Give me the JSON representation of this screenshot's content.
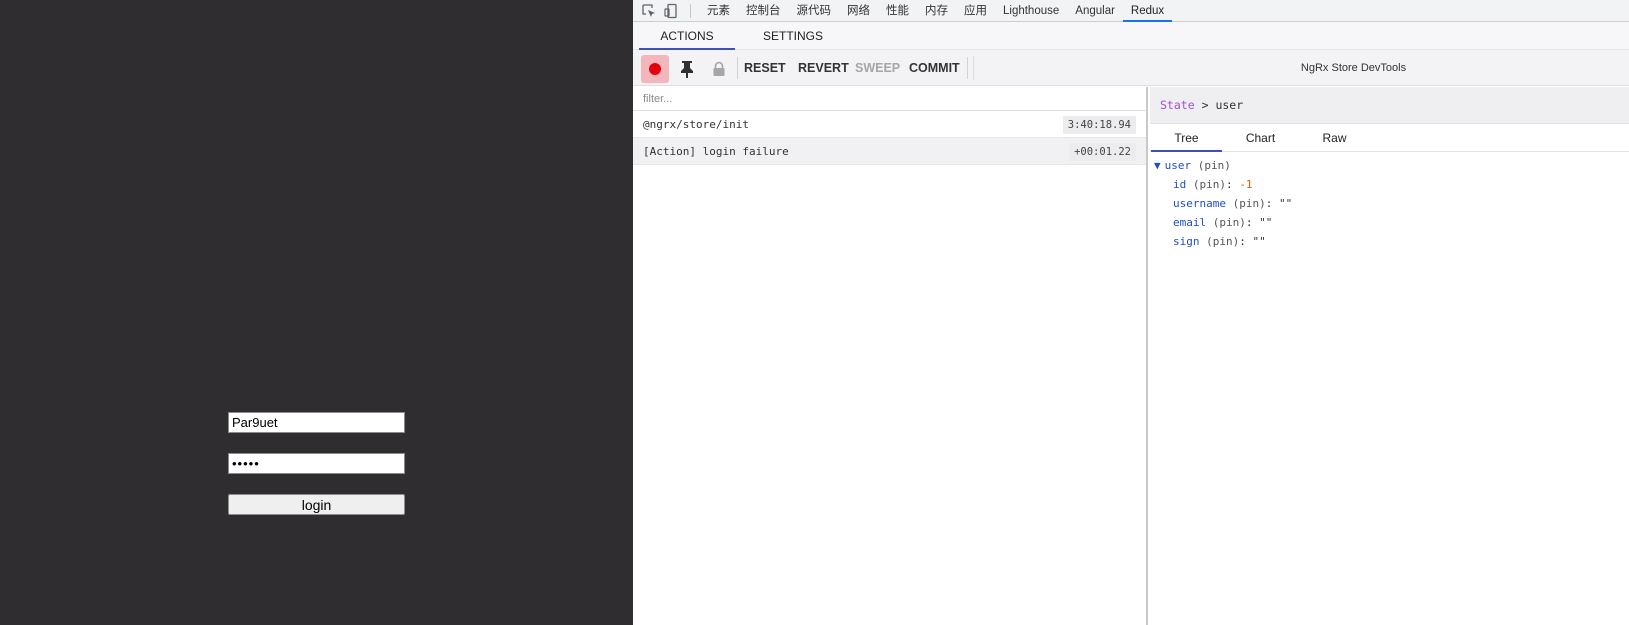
{
  "app": {
    "username_value": "Par9uet",
    "password_value": "•••••",
    "login_label": "login"
  },
  "devtools_tabs": [
    "元素",
    "控制台",
    "源代码",
    "网络",
    "性能",
    "内存",
    "应用",
    "Lighthouse",
    "Angular",
    "Redux"
  ],
  "devtools_active_tab": "Redux",
  "subtabs": {
    "actions": "ACTIONS",
    "settings": "SETTINGS"
  },
  "toolbar": {
    "reset": "RESET",
    "revert": "REVERT",
    "sweep": "SWEEP",
    "commit": "COMMIT",
    "instance_label": "NgRx Store DevTools",
    "record_color": "#e3000f"
  },
  "filter": {
    "placeholder": "filter..."
  },
  "actions": [
    {
      "name": "@ngrx/store/init",
      "time": "3:40:18.94"
    },
    {
      "name": "[Action] login failure",
      "time": "+00:01.22"
    }
  ],
  "state": {
    "root_label": "State",
    "separator": ">",
    "current": "user",
    "view_tabs": {
      "tree": "Tree",
      "chart": "Chart",
      "raw": "Raw"
    },
    "tree": {
      "root_key": "user",
      "pin_label": "(pin)",
      "nodes": [
        {
          "key": "id",
          "value": "-1"
        },
        {
          "key": "username",
          "value": "\"\""
        },
        {
          "key": "email",
          "value": "\"\""
        },
        {
          "key": "sign",
          "value": "\"\""
        }
      ]
    }
  },
  "colors": {
    "app_background": "#302d31",
    "accent_tab": "#3f51b5",
    "active_devtools_tab": "#1a73e8"
  }
}
